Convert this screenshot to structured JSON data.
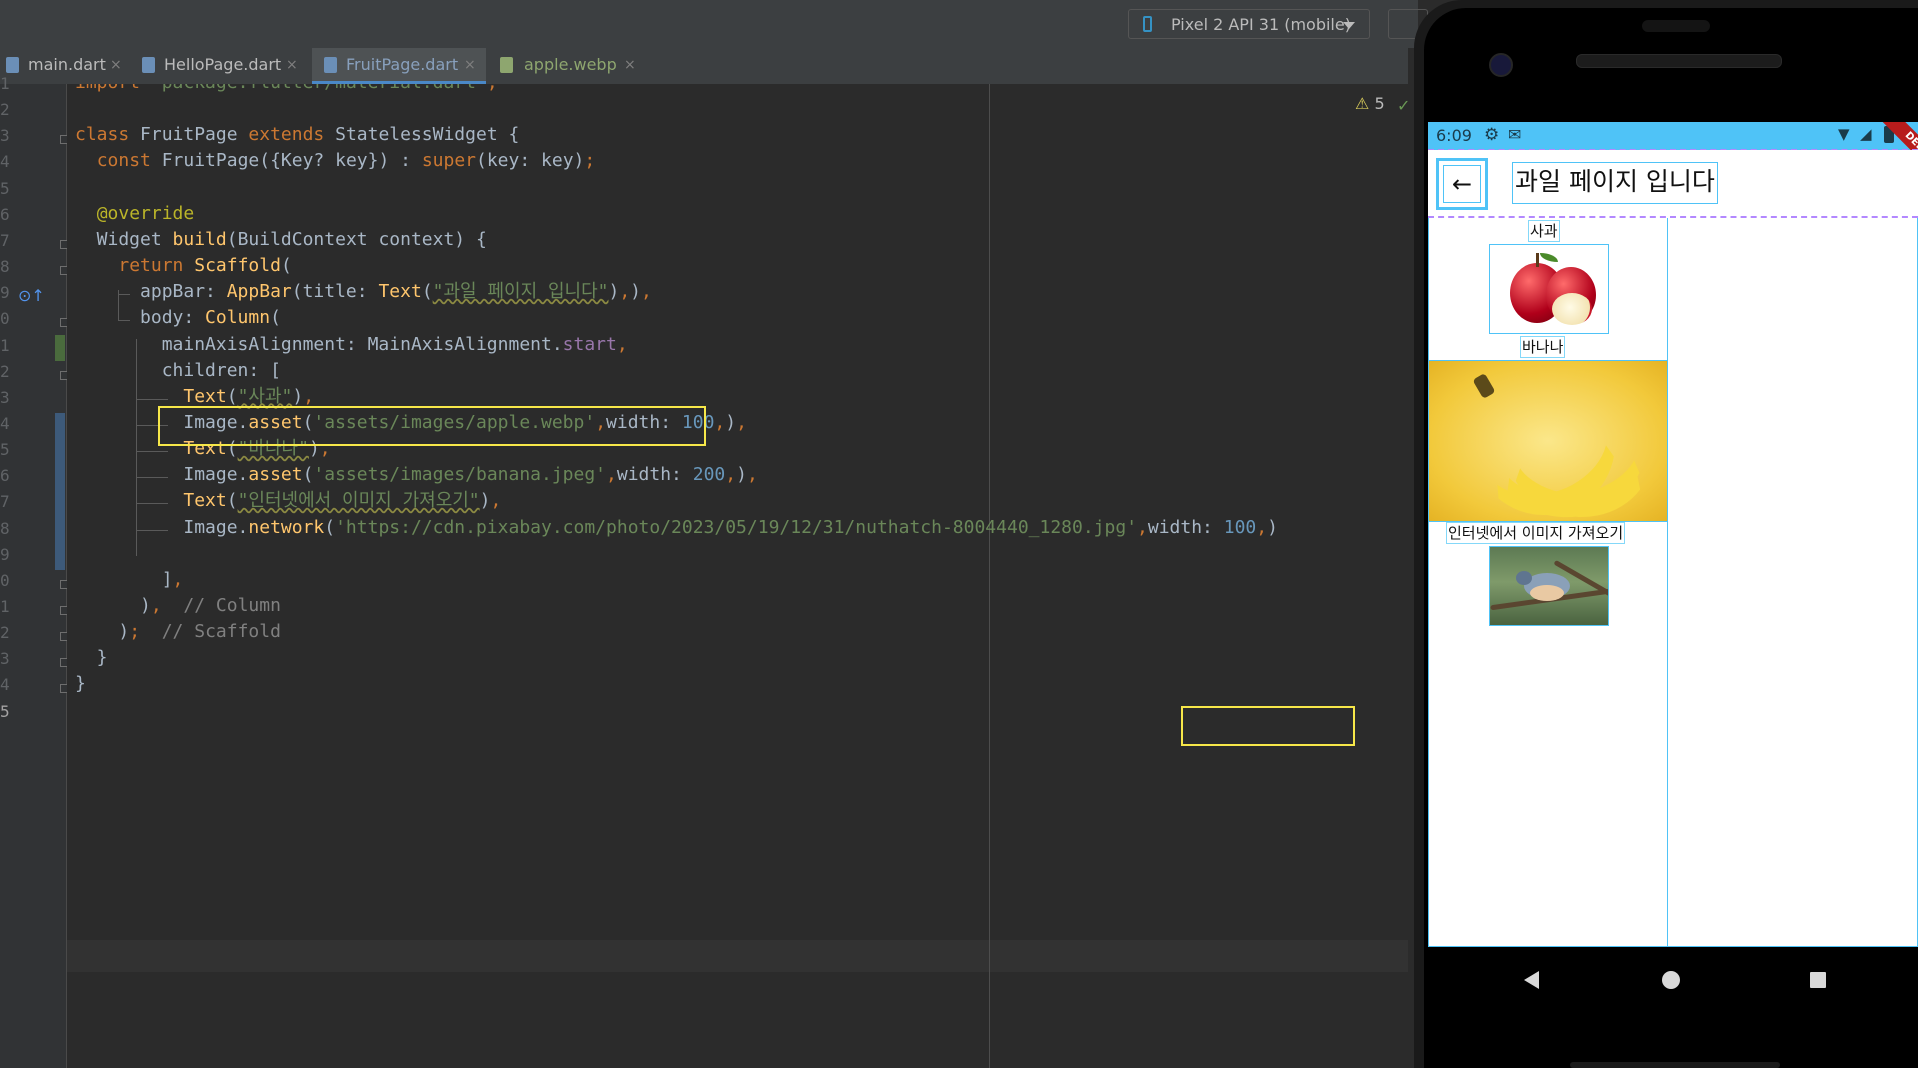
{
  "toolbar": {
    "device_selector": "Pixel 2 API 31 (mobile)"
  },
  "tabs": [
    {
      "label": "main.dart",
      "close": "×"
    },
    {
      "label": "HelloPage.dart",
      "close": "×"
    },
    {
      "label": "FruitPage.dart",
      "close": "×"
    },
    {
      "label": "apple.webp",
      "close": "×"
    }
  ],
  "editor": {
    "warnings_count": "5",
    "line_numbers": [
      "1",
      "2",
      "3",
      "4",
      "5",
      "6",
      "7",
      "8",
      "9",
      "0",
      "1",
      "2",
      "3",
      "4",
      "5",
      "6",
      "7",
      "8",
      "9",
      "0",
      "1",
      "2",
      "3",
      "4",
      "5"
    ],
    "current_line_index": 24,
    "lines": [
      "import 'package:flutter/material.dart';",
      "",
      "class FruitPage extends StatelessWidget {",
      "  const FruitPage({Key? key}) : super(key: key);",
      "",
      "  @override",
      "  Widget build(BuildContext context) {",
      "    return Scaffold(",
      "      appBar: AppBar(title: Text(\"과일 페이지 입니다\"),),",
      "      body: Column(",
      "        mainAxisAlignment: MainAxisAlignment.start,",
      "        children: [",
      "          Text(\"사과\"),",
      "          Image.asset('assets/images/apple.webp',width: 100,),",
      "          Text(\"바나나\"),",
      "          Image.asset('assets/images/banana.jpeg',width: 200,),",
      "          Text(\"인터넷에서 이미지 가져오기\"),",
      "          Image.network('https://cdn.pixabay.com/photo/2023/05/19/12/31/nuthatch-8004440_1280.jpg',width: 100,)",
      "",
      "        ],",
      "      ),  // Column",
      "    );  // Scaffold",
      "  }",
      "}",
      ""
    ]
  },
  "emulator": {
    "status_time": "6:09",
    "status_icons": [
      "gear-icon",
      "mail-icon",
      "wifi-icon",
      "signal-icon",
      "battery-icon"
    ],
    "debug_banner": "DEBUG",
    "appbar_title": "과일 페이지 입니다",
    "back_glyph": "←",
    "texts": {
      "apple": "사과",
      "banana": "바나나",
      "internet": "인터넷에서 이미지 가져오기"
    },
    "nav": [
      "back",
      "home",
      "recents"
    ]
  },
  "colors": {
    "accent": "#4a88c7",
    "highlight_box": "#f6e749",
    "statusbar": "#4fc3f7"
  }
}
